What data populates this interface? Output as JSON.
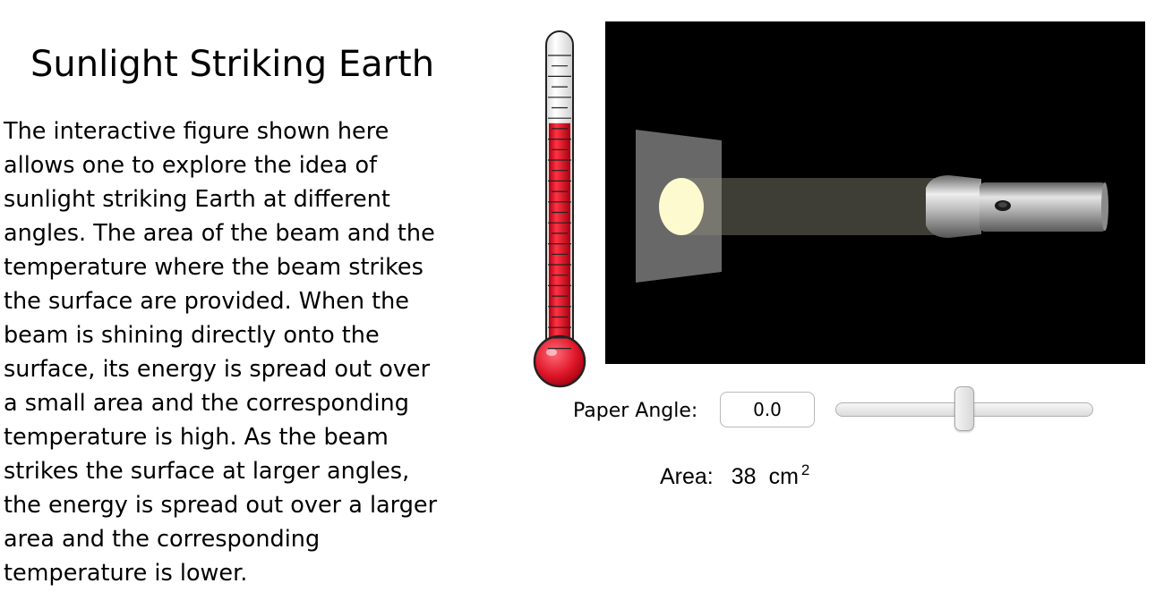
{
  "page": {
    "title": "Sunlight Striking Earth",
    "description": "The interactive figure shown here\nallows one to explore the idea of\nsunlight striking Earth at different\nangles.  The area of the beam and the\ntemperature where the beam strikes\nthe surface are provided.    When the\nbeam is shining directly onto the\nsurface, its energy is spread out over\na small area and the corresponding\ntemperature is high.  As the beam\nstrikes the surface at larger angles,\nthe energy is spread out over a larger\narea and the corresponding\ntemperature is lower."
  },
  "controls": {
    "paper_angle_label": "Paper Angle:",
    "paper_angle_value": "0.0"
  },
  "readout": {
    "area_label": "Area:",
    "area_value": "38",
    "area_unit": "cm",
    "area_exponent": "2"
  },
  "thermometer": {
    "fill_fraction": 0.73
  },
  "colors": {
    "thermometer_fill": "#e0182b",
    "stage_background": "#000000",
    "light_spot": "#fdfacf",
    "paper": "#7a7a7a",
    "flashlight": "#9a9a9a"
  },
  "icons": {
    "thermometer": "thermometer-icon",
    "flashlight": "flashlight-icon",
    "paper": "paper-sheet"
  }
}
